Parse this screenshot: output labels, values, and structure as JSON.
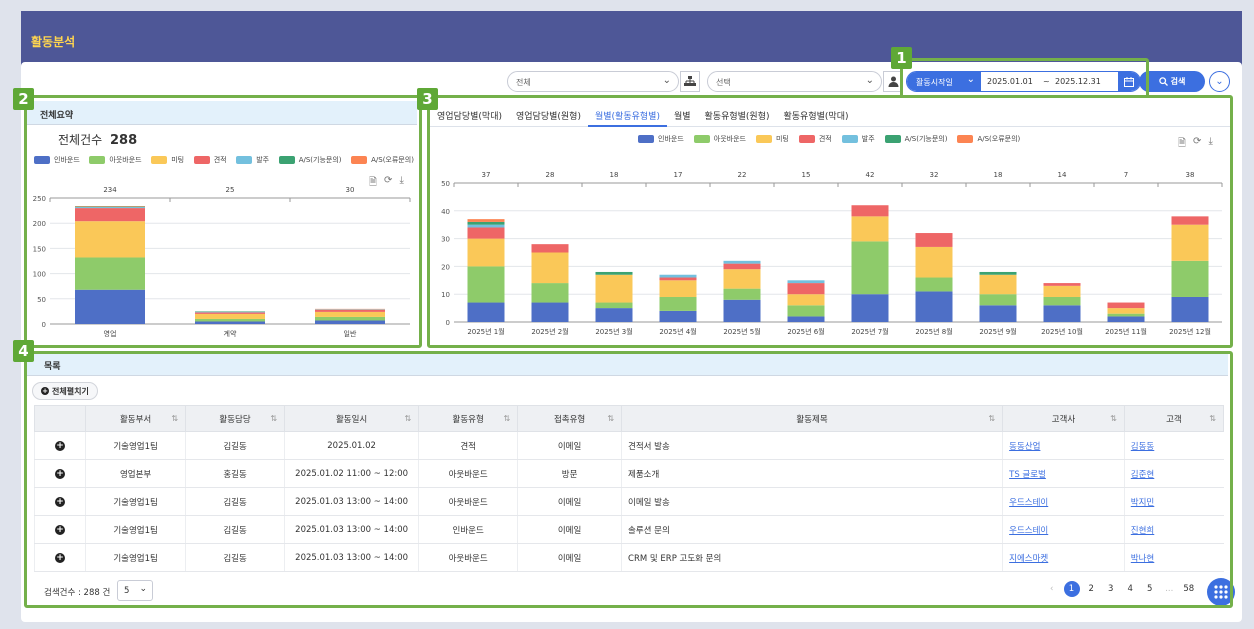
{
  "header": {
    "title": "활동분석"
  },
  "filters": {
    "org_select": "전체",
    "person_select": "선택",
    "date_type": "활동시작일",
    "date_start": "2025.01.01",
    "date_sep": "~",
    "date_end": "2025.12.31",
    "search_label": "검색"
  },
  "annotations": [
    "1",
    "2",
    "3",
    "4"
  ],
  "summary": {
    "heading": "전체요약",
    "total_label": "전체건수",
    "total_value": "288"
  },
  "tabs": [
    "영업담당별(막대)",
    "영업담당별(원형)",
    "월별(활동유형별)",
    "월별",
    "활동유형별(원형)",
    "활동유형별(막대)"
  ],
  "active_tab": 2,
  "colors": {
    "인바운드": "#4e6fc6",
    "아웃바운드": "#8ecb6a",
    "미팅": "#fac858",
    "견적": "#ee6666",
    "발주": "#73c0de",
    "A/S(기능문의)": "#3ba272",
    "A/S(오류문의)": "#fc8452"
  },
  "legend": [
    "인바운드",
    "아웃바운드",
    "미팅",
    "견적",
    "발주",
    "A/S(기능문의)",
    "A/S(오류문의)"
  ],
  "chart_data": [
    {
      "type": "bar",
      "stacked": true,
      "categories": [
        "영업",
        "계약",
        "일반"
      ],
      "totals": [
        "234",
        "25",
        "30"
      ],
      "ylim": [
        0,
        250
      ],
      "yticks": [
        "0",
        "50",
        "100",
        "150",
        "200",
        "250"
      ],
      "series": [
        {
          "name": "인바운드",
          "values": [
            68,
            5,
            7
          ]
        },
        {
          "name": "아웃바운드",
          "values": [
            64,
            5,
            7
          ]
        },
        {
          "name": "미팅",
          "values": [
            72,
            10,
            10
          ]
        },
        {
          "name": "견적",
          "values": [
            26,
            3,
            4
          ]
        },
        {
          "name": "발주",
          "values": [
            2,
            1,
            1
          ]
        },
        {
          "name": "A/S(기능문의)",
          "values": [
            1,
            1,
            0
          ]
        },
        {
          "name": "A/S(오류문의)",
          "values": [
            1,
            0,
            1
          ]
        }
      ]
    },
    {
      "type": "bar",
      "stacked": true,
      "categories": [
        "2025년 1월",
        "2025년 2월",
        "2025년 3월",
        "2025년 4월",
        "2025년 5월",
        "2025년 6월",
        "2025년 7월",
        "2025년 8월",
        "2025년 9월",
        "2025년 10월",
        "2025년 11월",
        "2025년 12월"
      ],
      "totals": [
        "37",
        "28",
        "18",
        "17",
        "22",
        "15",
        "42",
        "32",
        "18",
        "14",
        "7",
        "38"
      ],
      "ylim": [
        0,
        50
      ],
      "yticks": [
        "0",
        "10",
        "20",
        "30",
        "40",
        "50"
      ],
      "series": [
        {
          "name": "인바운드",
          "values": [
            7,
            7,
            5,
            4,
            8,
            2,
            10,
            11,
            6,
            6,
            2,
            9
          ]
        },
        {
          "name": "아웃바운드",
          "values": [
            13,
            7,
            2,
            5,
            4,
            4,
            19,
            5,
            4,
            3,
            1,
            13
          ]
        },
        {
          "name": "미팅",
          "values": [
            10,
            11,
            10,
            6,
            7,
            4,
            9,
            11,
            7,
            4,
            2,
            13
          ]
        },
        {
          "name": "견적",
          "values": [
            4,
            3,
            0,
            1,
            2,
            4,
            4,
            5,
            0,
            1,
            2,
            3
          ]
        },
        {
          "name": "발주",
          "values": [
            1,
            0,
            0,
            1,
            1,
            1,
            0,
            0,
            0,
            0,
            0,
            0
          ]
        },
        {
          "name": "A/S(기능문의)",
          "values": [
            1,
            0,
            1,
            0,
            0,
            0,
            0,
            0,
            1,
            0,
            0,
            0
          ]
        },
        {
          "name": "A/S(오류문의)",
          "values": [
            1,
            0,
            0,
            0,
            0,
            0,
            0,
            0,
            0,
            0,
            0,
            0
          ]
        }
      ]
    }
  ],
  "list": {
    "heading": "목록",
    "expand_all": "전체펼치기",
    "columns": [
      "활동부서",
      "활동담당",
      "활동일시",
      "활동유형",
      "접촉유형",
      "활동제목",
      "고객사",
      "고객"
    ],
    "rows": [
      [
        "기술영업1팀",
        "김길동",
        "2025.01.02",
        "견적",
        "이메일",
        "견적서 발송",
        "동동산업",
        "김동동"
      ],
      [
        "영업본부",
        "홍길동",
        "2025.01.02 11:00 ~ 12:00",
        "아웃바운드",
        "방문",
        "제품소개",
        "TS 글로벌",
        "김준현"
      ],
      [
        "기술영업1팀",
        "김길동",
        "2025.01.03 13:00 ~ 14:00",
        "아웃바운드",
        "이메일",
        "이메일 발송",
        "우드스테이",
        "박지민"
      ],
      [
        "기술영업1팀",
        "김길동",
        "2025.01.03 13:00 ~ 14:00",
        "인바운드",
        "이메일",
        "솔루션 문의",
        "우드스테이",
        "진현희"
      ],
      [
        "기술영업1팀",
        "김길동",
        "2025.01.03 13:00 ~ 14:00",
        "아웃바운드",
        "이메일",
        "CRM 및 ERP 고도화 문의",
        "지에스마켓",
        "박나현"
      ]
    ],
    "count_label": "검색건수 : 288 건",
    "page_size": "5",
    "pages": [
      "1",
      "2",
      "3",
      "4",
      "5",
      "...",
      "58"
    ]
  }
}
